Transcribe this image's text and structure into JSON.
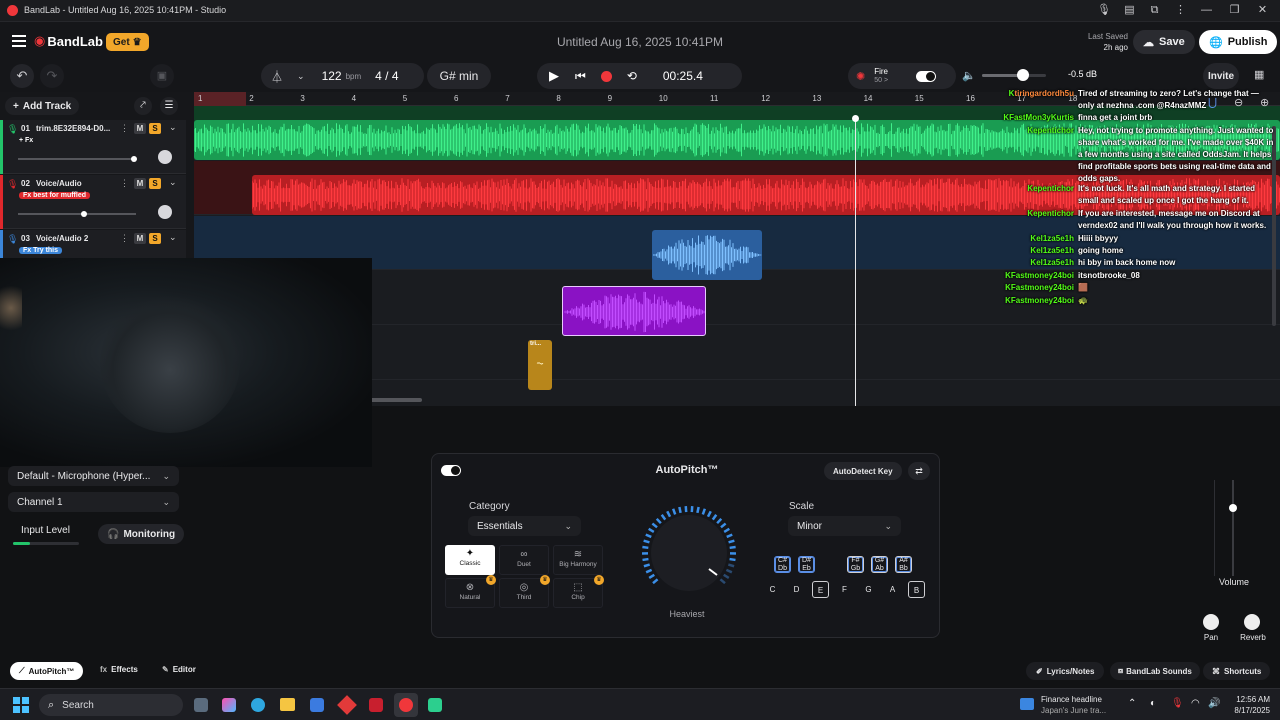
{
  "window": {
    "title": "BandLab - Untitled Aug 16, 2025 10:41PM - Studio"
  },
  "header": {
    "brand": "BandLab",
    "get_label": "Get",
    "project_title": "Untitled Aug 16, 2025 10:41PM",
    "last_saved_label": "Last Saved",
    "last_saved_value": "2h ago",
    "save_label": "Save",
    "publish_label": "Publish"
  },
  "transport": {
    "bpm": "122",
    "bpm_unit": "bpm",
    "time_sig": "4 / 4",
    "key": "G# min",
    "time": "00:25.4",
    "preset_name": "Fire",
    "preset_sub": "50 >",
    "volume_db": "-0.5 dB",
    "invite_label": "Invite"
  },
  "tracks_toolbar": {
    "add_track": "Add Track"
  },
  "ruler": [
    "1",
    "2",
    "3",
    "4",
    "5",
    "6",
    "7",
    "8",
    "9",
    "10",
    "11",
    "12",
    "13",
    "14",
    "15",
    "16",
    "17",
    "18"
  ],
  "tracks": [
    {
      "num": "01",
      "name": "trim.8E32E894-D0...",
      "fx": "+ Fx",
      "color": "#23c46a"
    },
    {
      "num": "02",
      "name": "Voice/Audio",
      "fx": "Fx best for muffled",
      "color": "#e0282c"
    },
    {
      "num": "03",
      "name": "Voice/Audio 2",
      "fx": "Fx Try this",
      "color": "#3c86d9"
    }
  ],
  "clip_label": "tri...",
  "input": {
    "device": "Default - Microphone (Hyper...",
    "channel": "Channel 1",
    "input_level": "Input Level",
    "monitoring": "Monitoring",
    "level": 0.25
  },
  "autopitch": {
    "title": "AutoPitch™",
    "autodetect": "AutoDetect Key",
    "category_label": "Category",
    "category_value": "Essentials",
    "scale_label": "Scale",
    "scale_value": "Minor",
    "dial_label": "Heaviest",
    "effects": [
      {
        "name": "Classic",
        "selected": true,
        "icon": "sparkle-icon"
      },
      {
        "name": "Duet",
        "selected": false,
        "icon": "duet-icon"
      },
      {
        "name": "Big Harmony",
        "selected": false,
        "icon": "harmony-icon"
      },
      {
        "name": "Natural",
        "selected": false,
        "icon": "natural-icon",
        "premium": true
      },
      {
        "name": "Third",
        "selected": false,
        "icon": "third-icon",
        "premium": true
      },
      {
        "name": "Chip",
        "selected": false,
        "icon": "chip-icon",
        "premium": true
      }
    ],
    "sharps": [
      {
        "top": "C#",
        "bot": "Db",
        "active": true
      },
      {
        "top": "D#",
        "bot": "Eb",
        "active": true
      },
      {
        "top": "F#",
        "bot": "Gb",
        "active": true
      },
      {
        "top": "G#",
        "bot": "Ab",
        "active": true
      },
      {
        "top": "A#",
        "bot": "Bb",
        "active": true
      }
    ],
    "naturals": [
      {
        "n": "C",
        "active": false
      },
      {
        "n": "D",
        "active": false
      },
      {
        "n": "E",
        "active": true
      },
      {
        "n": "F",
        "active": false
      },
      {
        "n": "G",
        "active": false
      },
      {
        "n": "A",
        "active": false
      },
      {
        "n": "B",
        "active": true
      }
    ]
  },
  "right_panel": {
    "volume": "Volume",
    "pan": "Pan",
    "reverb": "Reverb"
  },
  "bottom_tabs": {
    "autopitch": "AutoPitch™",
    "effects": "Effects",
    "editor": "Editor",
    "lyrics": "Lyrics/Notes",
    "sounds": "BandLab Sounds",
    "shortcuts": "Shortcuts"
  },
  "chat": [
    {
      "user": "tiringardordh5u",
      "color": "#ff8a3d",
      "msg": "Tired of streaming to zero? Let's change that — only at nezhna .com @R4nazMMZ"
    },
    {
      "user": "FastMon3yKurtis",
      "color": "#53fc18",
      "msg": "finna get a joint brb"
    },
    {
      "user": "epentichor",
      "color": "#53fc18",
      "msg": "Hey, not trying to promote anything. Just wanted to share what's worked for me. I've made over $40K in a few months using a site called OddsJam. It helps find profitable sports bets using real-time data and odds gaps."
    },
    {
      "user": "epentichor",
      "color": "#53fc18",
      "msg": "It's not luck. It's all math and strategy. I started small and scaled up once I got the hang of it."
    },
    {
      "user": "epentichor",
      "color": "#53fc18",
      "msg": "If you are interested, message me on Discord at verndex02 and I'll walk you through how it works."
    },
    {
      "user": "el1za5e1h",
      "color": "#53fc18",
      "msg": "Hiiii bbyyy"
    },
    {
      "user": "el1za5e1h",
      "color": "#53fc18",
      "msg": "going home"
    },
    {
      "user": "el1za5e1h",
      "color": "#53fc18",
      "msg": "hi bby im back home now"
    },
    {
      "user": "Fastmoney24boi",
      "color": "#53fc18",
      "msg": "itsnotbrooke_08"
    },
    {
      "user": "Fastmoney24boi",
      "color": "#53fc18",
      "msg": "🟫"
    },
    {
      "user": "Fastmoney24boi",
      "color": "#53fc18",
      "msg": "🐢"
    }
  ],
  "taskbar": {
    "search": "Search",
    "news_title": "Finance headline",
    "news_sub": "Japan's June tra...",
    "time": "12:56 AM",
    "date": "8/17/2025"
  }
}
